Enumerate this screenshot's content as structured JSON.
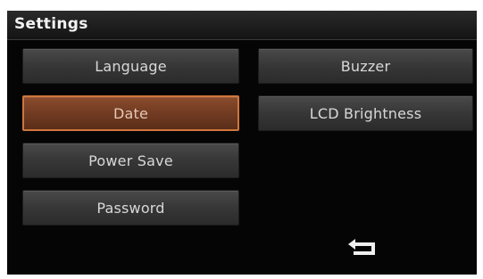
{
  "header": {
    "title": "Settings"
  },
  "menu": {
    "left": [
      {
        "label": "Language",
        "selected": false
      },
      {
        "label": "Date",
        "selected": true
      },
      {
        "label": "Power Save",
        "selected": false
      },
      {
        "label": "Password",
        "selected": false
      }
    ],
    "right": [
      {
        "label": "Buzzer",
        "selected": false
      },
      {
        "label": "LCD Brightness",
        "selected": false
      }
    ]
  },
  "footer": {
    "back_icon": "return-arrow-icon"
  },
  "colors": {
    "background": "#050505",
    "button": "#383838",
    "selected_fill": "#6f3a21",
    "selected_border": "#d0763c",
    "text": "#d8d8d8"
  }
}
